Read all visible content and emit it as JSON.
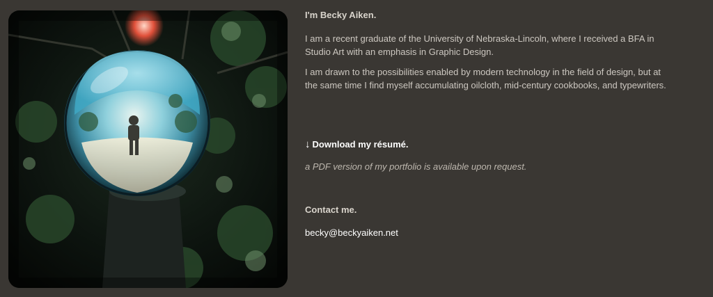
{
  "photo": {
    "icon": "mirror-ball-photo"
  },
  "about": {
    "heading": "I'm Becky Aiken.",
    "paragraphs": [
      "I am a recent graduate of the University of Nebraska-Lincoln, where I received a BFA in Studio Art with an emphasis in Graphic Design.",
      "I am drawn to the possibilities enabled by modern technology in the field of design, but at the same time I find myself accumulating oilcloth, mid-century cookbooks, and typewriters."
    ]
  },
  "resume": {
    "arrow": "↓",
    "link_label": "Download my résumé.",
    "note": "a PDF version of my portfolio is available upon request."
  },
  "contact": {
    "heading": "Contact me.",
    "email": "becky@beckyaiken.net"
  },
  "colors": {
    "background": "#3a3733",
    "text": "#cdc8c1",
    "link": "#ffffff"
  }
}
